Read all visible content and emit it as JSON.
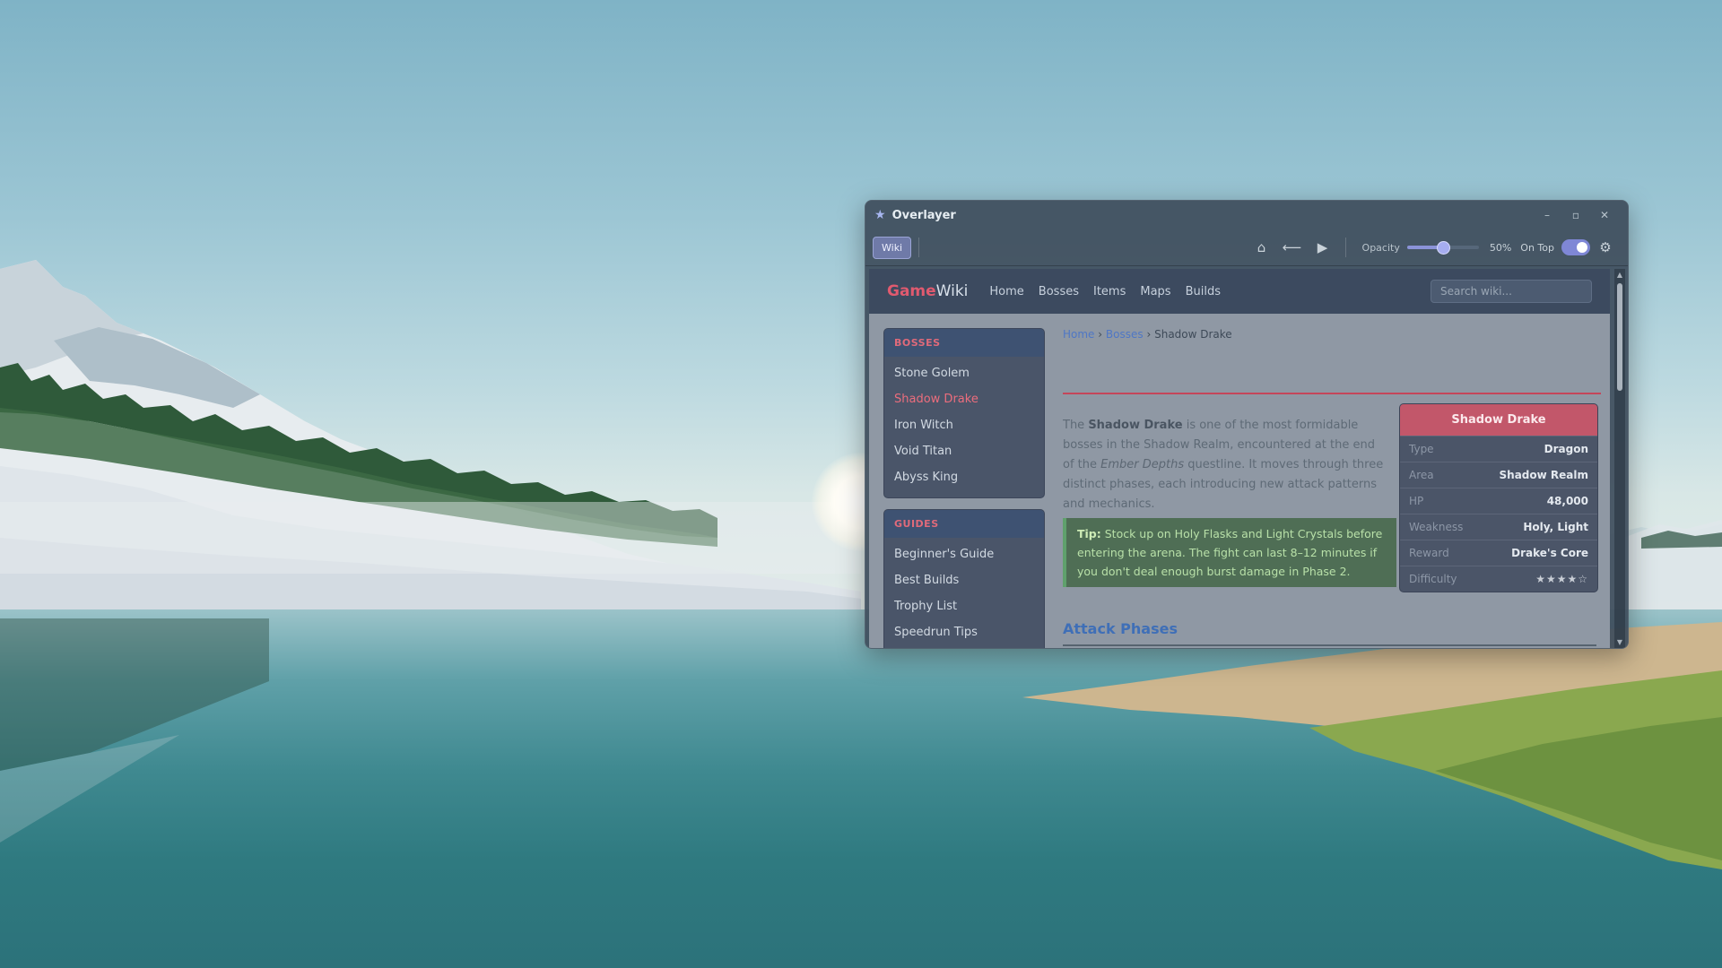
{
  "window": {
    "title": "Overlayer",
    "minimize": "–",
    "maximize": "▫",
    "close": "✕"
  },
  "toolbar": {
    "tab_label": "Wiki",
    "home_icon": "⌂",
    "back_icon": "⟵",
    "play_icon": "▶",
    "opacity_label": "Opacity",
    "opacity_value": "50%",
    "opacity_fraction": 0.5,
    "ontop_label": "On Top",
    "ontop_enabled": true,
    "settings_icon": "⚙"
  },
  "wiki": {
    "logo_game": "Game",
    "logo_wiki": "Wiki",
    "nav": [
      "Home",
      "Bosses",
      "Items",
      "Maps",
      "Builds"
    ],
    "search_placeholder": "Search wiki..."
  },
  "sidebar": {
    "bosses_heading": "BOSSES",
    "bosses": [
      "Stone Golem",
      "Shadow Drake",
      "Iron Witch",
      "Void Titan",
      "Abyss King"
    ],
    "active_boss": "Shadow Drake",
    "guides_heading": "GUIDES",
    "guides": [
      "Beginner's Guide",
      "Best Builds",
      "Trophy List",
      "Speedrun Tips"
    ]
  },
  "article": {
    "breadcrumb": [
      "Home",
      "Bosses",
      "Shadow Drake"
    ],
    "breadcrumb_sep": "›",
    "intro_1": "The ",
    "intro_bold": "Shadow Drake",
    "intro_2": " is one of the most formidable bosses in the Shadow Realm, encountered at the end of the ",
    "intro_italic": "Ember Depths",
    "intro_3": " questline. It moves through three distinct phases, each introducing new attack patterns and mechanics.",
    "tip_label": "Tip:",
    "tip_text": " Stock up on Holy Flasks and Light Crystals before entering the arena. The fight can last 8–12 minutes if you don't deal enough burst damage in Phase 2.",
    "section_heading": "Attack Phases"
  },
  "infobox": {
    "title": "Shadow Drake",
    "rows": [
      {
        "key": "Type",
        "value": "Dragon"
      },
      {
        "key": "Area",
        "value": "Shadow Realm"
      },
      {
        "key": "HP",
        "value": "48,000"
      },
      {
        "key": "Weakness",
        "value": "Holy, Light"
      },
      {
        "key": "Reward",
        "value": "Drake's Core"
      },
      {
        "key": "Difficulty",
        "value": "★★★★☆"
      }
    ],
    "difficulty_rating": 4,
    "difficulty_max": 5
  },
  "colors": {
    "accent": "#8b93d8",
    "brand_red": "#e05a6f",
    "link_blue": "#4f77c5",
    "tip_green": "#5fa16c"
  },
  "icons": {
    "app": "star-icon",
    "home": "home-icon",
    "back": "back-arrow-icon",
    "play": "play-icon",
    "settings": "gear-icon"
  }
}
